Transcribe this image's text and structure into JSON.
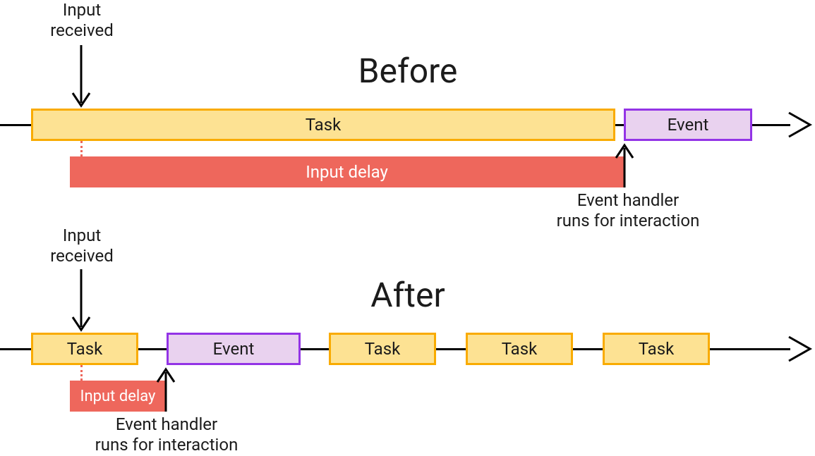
{
  "titles": {
    "before": "Before",
    "after": "After"
  },
  "labels": {
    "input_received": "Input\nreceived",
    "task": "Task",
    "event": "Event",
    "input_delay": "Input delay",
    "handler": "Event handler\nruns for interaction"
  },
  "colors": {
    "task_fill": "#fde293",
    "task_border": "#f9ab00",
    "event_fill": "#e9d2ef",
    "event_border": "#9334e6",
    "delay_fill": "#ee675c"
  },
  "chart_data": [
    {
      "type": "timeline",
      "title": "Before",
      "items": [
        {
          "kind": "task",
          "label": "Task",
          "start": 0,
          "width": 0.77
        },
        {
          "kind": "event",
          "label": "Event",
          "start": 0.78,
          "width": 0.17
        }
      ],
      "input_received_at": 0.06,
      "input_delay": {
        "start": 0.06,
        "end": 0.78,
        "label": "Input delay"
      },
      "handler_starts_at": 0.78,
      "handler_label": "Event handler runs for interaction"
    },
    {
      "type": "timeline",
      "title": "After",
      "items": [
        {
          "kind": "task",
          "label": "Task",
          "start": 0.0,
          "width": 0.14
        },
        {
          "kind": "event",
          "label": "Event",
          "start": 0.18,
          "width": 0.18
        },
        {
          "kind": "task",
          "label": "Task",
          "start": 0.4,
          "width": 0.14
        },
        {
          "kind": "task",
          "label": "Task",
          "start": 0.58,
          "width": 0.14
        },
        {
          "kind": "task",
          "label": "Task",
          "start": 0.76,
          "width": 0.14
        }
      ],
      "input_received_at": 0.06,
      "input_delay": {
        "start": 0.06,
        "end": 0.18,
        "label": "Input delay"
      },
      "handler_starts_at": 0.18,
      "handler_label": "Event handler runs for interaction"
    }
  ]
}
